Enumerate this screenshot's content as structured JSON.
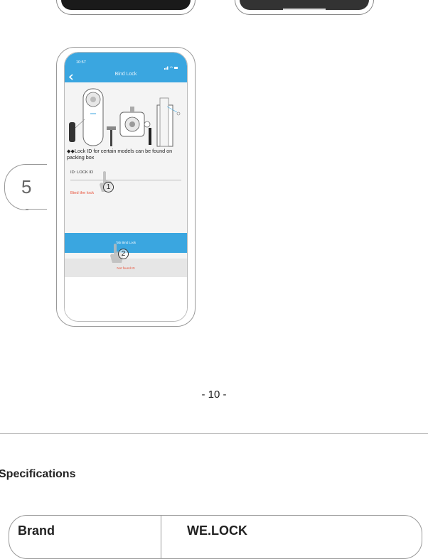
{
  "app": {
    "status_time": "10:57",
    "title": "Bind Lock",
    "lock_id_note": "◆◆Lock ID for certain models can be found on packing box",
    "id_label": "ID: LOCK ID",
    "bind_text": "Bind the lock",
    "tab_button": "Tab Bind Lock",
    "not_found": "Not found ID",
    "marker_1": "1",
    "marker_2": "2"
  },
  "step": {
    "number": "5"
  },
  "page": {
    "number": "- 10 -"
  },
  "section": {
    "title": "Specifications"
  },
  "table": {
    "label": "Brand",
    "value": "WE.LOCK"
  },
  "icons": [
    "back-chevron-icon",
    "signal-icon",
    "wifi-icon",
    "battery-icon",
    "finger-pointer-icon"
  ],
  "colors": {
    "accent": "#3aa6e0",
    "warning": "#e8523a"
  }
}
